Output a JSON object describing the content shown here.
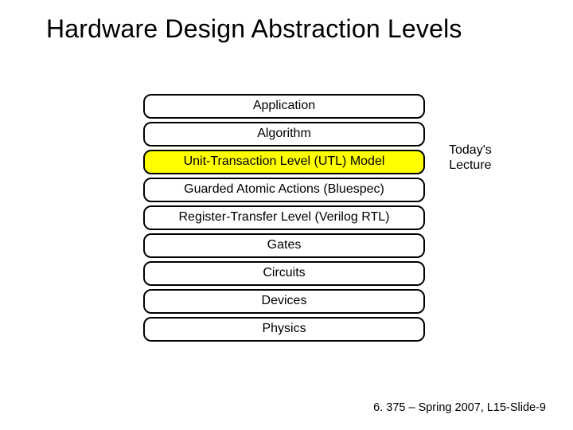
{
  "title": "Hardware Design Abstraction Levels",
  "levels": [
    {
      "label": "Application",
      "highlight": false
    },
    {
      "label": "Algorithm",
      "highlight": false
    },
    {
      "label": "Unit-Transaction Level (UTL) Model",
      "highlight": true
    },
    {
      "label": "Guarded Atomic Actions (Bluespec)",
      "highlight": false
    },
    {
      "label": "Register-Transfer Level (Verilog RTL)",
      "highlight": false
    },
    {
      "label": "Gates",
      "highlight": false
    },
    {
      "label": "Circuits",
      "highlight": false
    },
    {
      "label": "Devices",
      "highlight": false
    },
    {
      "label": "Physics",
      "highlight": false
    }
  ],
  "annotation": {
    "line1": "Today's",
    "line2": "Lecture"
  },
  "footer": "6. 375 – Spring 2007, L15-Slide-9",
  "colors": {
    "highlight": "#ffff00",
    "border": "#000000",
    "bg": "#ffffff"
  }
}
